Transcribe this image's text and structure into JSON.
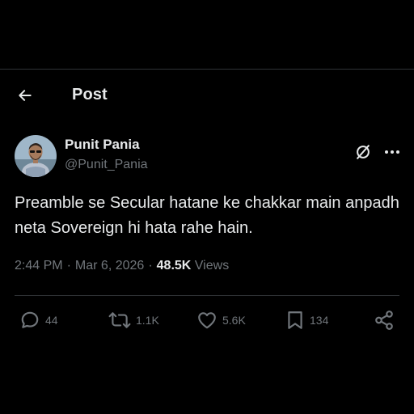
{
  "header": {
    "title": "Post",
    "back_icon": "arrow-left-icon"
  },
  "author": {
    "display_name": "Punit Pania",
    "handle": "@Punit_Pania",
    "avatar_icon": "user-avatar"
  },
  "post": {
    "text": "Preamble se Secular hatane ke chakkar main anpadh neta Sovereign hi hata rahe hain."
  },
  "meta": {
    "time": "2:44 PM",
    "date": "Mar 6, 2026",
    "separator": "·",
    "views_count": "48.5K",
    "views_label": "Views"
  },
  "actions": {
    "replies": "44",
    "reposts": "1.1K",
    "likes": "5.6K",
    "bookmarks": "134"
  },
  "colors": {
    "background": "#000000",
    "text_primary": "#e7e9ea",
    "text_secondary": "#71767b",
    "divider": "#2f3336"
  }
}
